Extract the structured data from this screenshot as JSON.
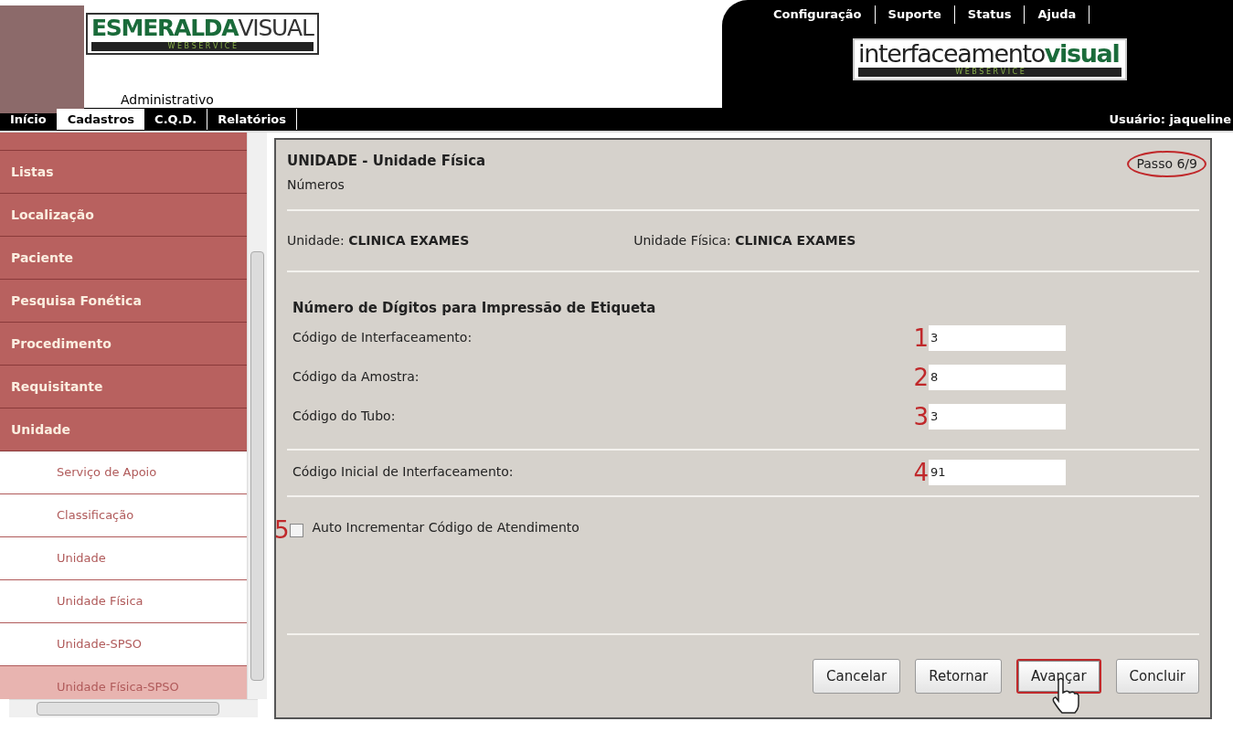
{
  "header": {
    "logo_left": {
      "main": "ESMERALDA",
      "accent": "VISUAL",
      "tagline": "W E B S E R V I C E"
    },
    "module": "Administrativo",
    "top_links": [
      "Configuração",
      "Suporte",
      "Status",
      "Ajuda"
    ],
    "logo_right": {
      "main": "interfaceamento",
      "accent": "visual",
      "tagline": "W E B S E R V I C E"
    }
  },
  "nav": {
    "tabs": [
      {
        "label": "Início",
        "selected": false
      },
      {
        "label": "Cadastros",
        "selected": true
      },
      {
        "label": "C.Q.D.",
        "selected": false
      },
      {
        "label": "Relatórios",
        "selected": false
      }
    ],
    "user": "Usuário: jaqueline"
  },
  "sidebar": {
    "items": [
      {
        "label": "Listas",
        "kind": "category",
        "selected": false
      },
      {
        "label": "Localização",
        "kind": "category",
        "selected": false
      },
      {
        "label": "Paciente",
        "kind": "category",
        "selected": false
      },
      {
        "label": "Pesquisa Fonética",
        "kind": "category",
        "selected": false
      },
      {
        "label": "Procedimento",
        "kind": "category",
        "selected": false
      },
      {
        "label": "Requisitante",
        "kind": "category",
        "selected": false
      },
      {
        "label": "Unidade",
        "kind": "category",
        "selected": false
      },
      {
        "label": "Serviço de Apoio",
        "kind": "subitem",
        "selected": false
      },
      {
        "label": "Classificação",
        "kind": "subitem",
        "selected": false
      },
      {
        "label": "Unidade",
        "kind": "subitem",
        "selected": false
      },
      {
        "label": "Unidade Física",
        "kind": "subitem",
        "selected": false
      },
      {
        "label": "Unidade-SPSO",
        "kind": "subitem",
        "selected": false
      },
      {
        "label": "Unidade Física-SPSO",
        "kind": "subitem",
        "selected": true
      }
    ]
  },
  "panel": {
    "title": "UNIDADE - Unidade Física",
    "subtitle": "Números",
    "step": {
      "text": "Passo 6/9",
      "circled": true
    },
    "info": [
      {
        "label": "Unidade: ",
        "value": "CLINICA EXAMES"
      },
      {
        "label": "Unidade Física: ",
        "value": "CLINICA EXAMES"
      }
    ],
    "section_title": "Número de Dígitos para Impressão de Etiqueta",
    "fields": [
      {
        "marker": "1",
        "label": "Código de Interfaceamento:",
        "value": "3"
      },
      {
        "marker": "2",
        "label": "Código da Amostra:",
        "value": "8"
      },
      {
        "marker": "3",
        "label": "Código do Tubo:",
        "value": "3"
      }
    ],
    "initial_field": {
      "marker": "4",
      "label": "Código Inicial de Interfaceamento:",
      "value": "91"
    },
    "checkbox": {
      "marker": "5",
      "label": "Auto Incrementar Código de Atendimento",
      "checked": false
    },
    "buttons": [
      {
        "label": "Cancelar",
        "highlighted": false
      },
      {
        "label": "Retornar",
        "highlighted": false
      },
      {
        "label": "Avançar",
        "highlighted": true
      },
      {
        "label": "Concluir",
        "highlighted": false
      }
    ]
  }
}
